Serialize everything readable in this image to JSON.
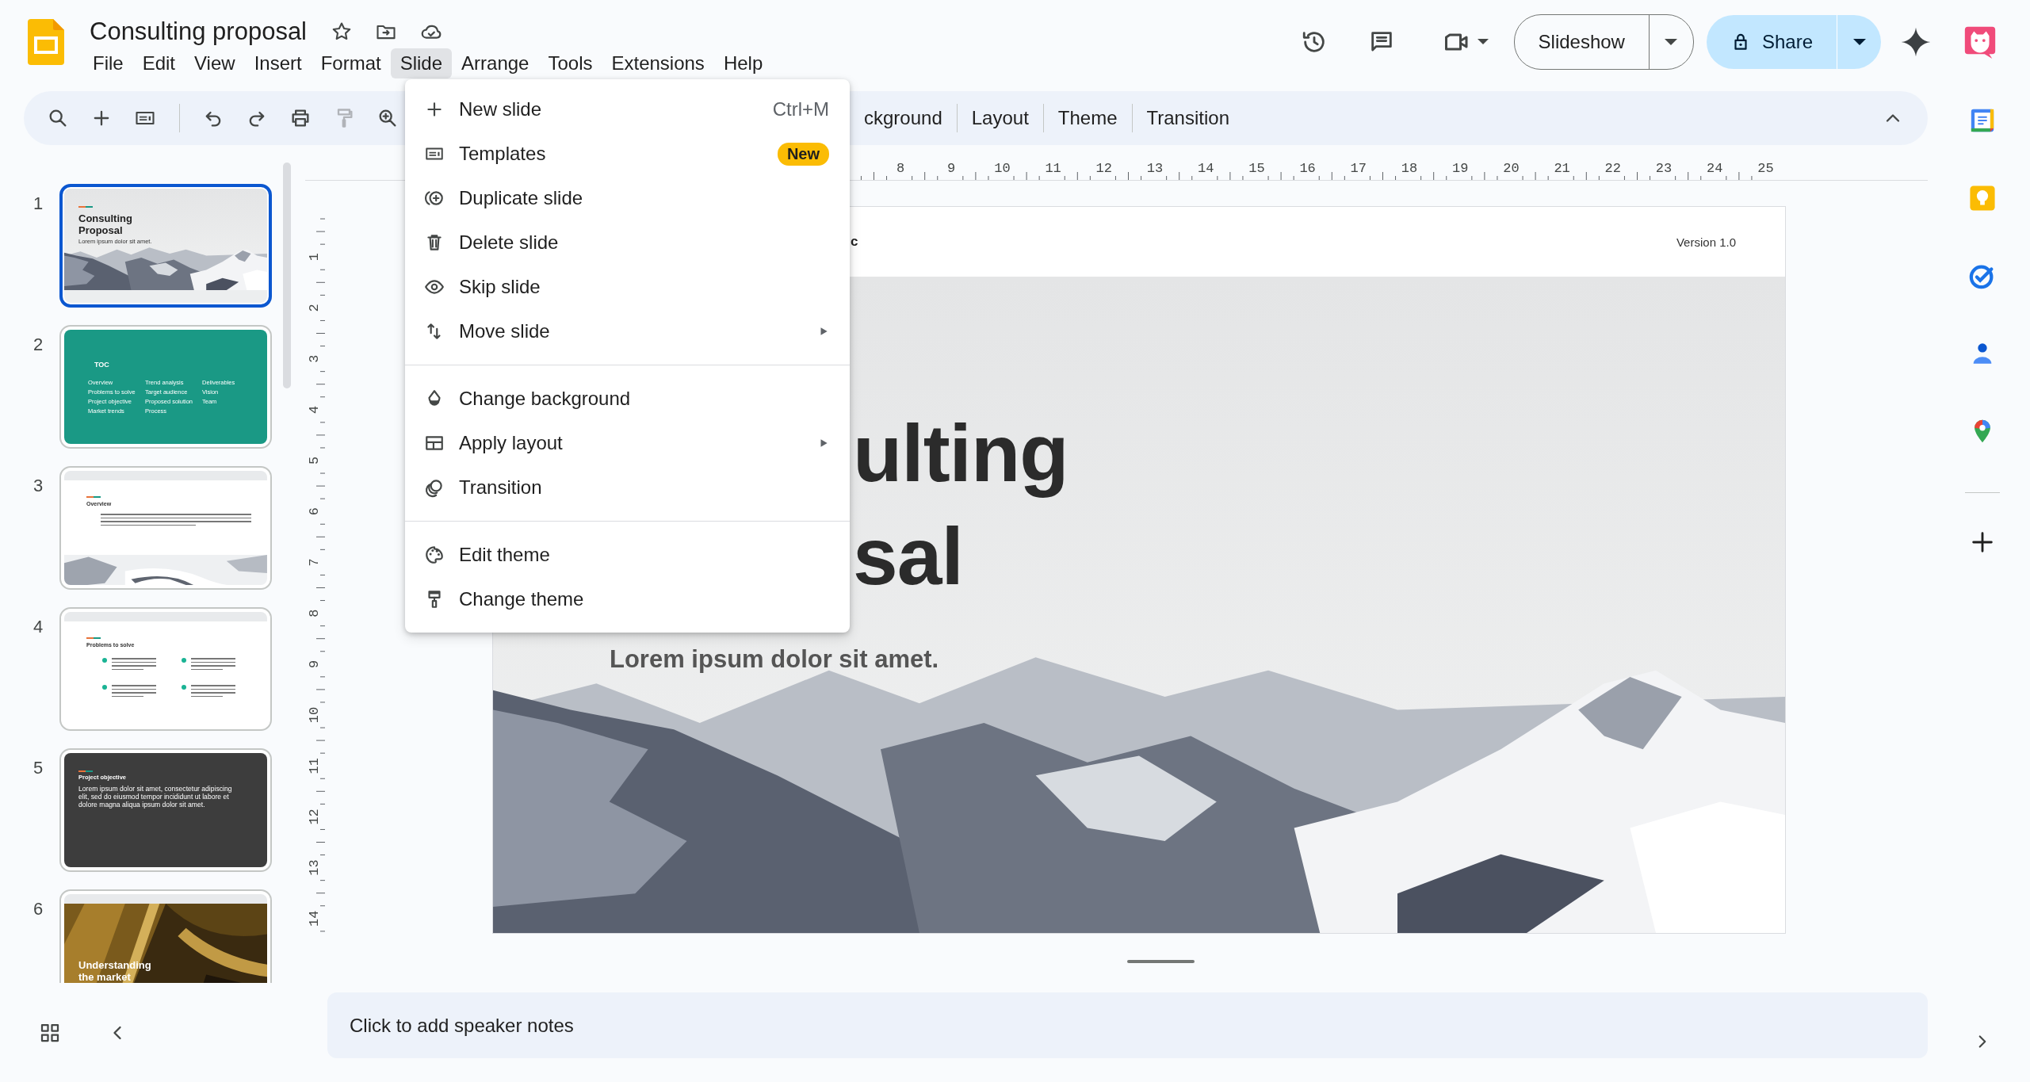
{
  "document": {
    "title": "Consulting proposal"
  },
  "menu_bar": [
    {
      "label": "File",
      "selected": false
    },
    {
      "label": "Edit",
      "selected": false
    },
    {
      "label": "View",
      "selected": false
    },
    {
      "label": "Insert",
      "selected": false
    },
    {
      "label": "Format",
      "selected": false
    },
    {
      "label": "Slide",
      "selected": true
    },
    {
      "label": "Arrange",
      "selected": false
    },
    {
      "label": "Tools",
      "selected": false
    },
    {
      "label": "Extensions",
      "selected": false
    },
    {
      "label": "Help",
      "selected": false
    }
  ],
  "header_actions": {
    "slideshow": "Slideshow",
    "share": "Share"
  },
  "toolbar": {
    "buttons": [
      "ckground",
      "Layout",
      "Theme",
      "Transition"
    ]
  },
  "slide_menu": {
    "groups": [
      [
        {
          "label": "New slide",
          "shortcut": "Ctrl+M",
          "submenu": false
        },
        {
          "label": "Templates",
          "badge": "New",
          "submenu": false
        },
        {
          "label": "Duplicate slide",
          "submenu": false
        },
        {
          "label": "Delete slide",
          "submenu": false
        },
        {
          "label": "Skip slide",
          "submenu": false
        },
        {
          "label": "Move slide",
          "submenu": true
        }
      ],
      [
        {
          "label": "Change background",
          "submenu": false
        },
        {
          "label": "Apply layout",
          "submenu": true
        },
        {
          "label": "Transition",
          "submenu": false
        }
      ],
      [
        {
          "label": "Edit theme",
          "submenu": false
        },
        {
          "label": "Change theme",
          "submenu": false
        }
      ]
    ]
  },
  "slides": [
    {
      "number": "1",
      "selected": true,
      "kind": "title",
      "title_lines": [
        "Consulting",
        "Proposal"
      ],
      "subtitle": "Lorem ipsum dolor sit amet."
    },
    {
      "number": "2",
      "selected": false,
      "kind": "toc",
      "title": "TOC",
      "columns": [
        [
          "Overview",
          "Problems to solve",
          "Project objective",
          "Market trends"
        ],
        [
          "Trend analysis",
          "Target audience",
          "Proposed solution",
          "Process"
        ],
        [
          "Deliverables",
          "Vision",
          "Team"
        ]
      ]
    },
    {
      "number": "3",
      "selected": false,
      "kind": "overview",
      "title": "Overview"
    },
    {
      "number": "4",
      "selected": false,
      "kind": "bullets",
      "title": "Problems to solve"
    },
    {
      "number": "5",
      "selected": false,
      "kind": "statement",
      "label": "Project objective",
      "text": "Lorem ipsum dolor sit amet, consectetur adipiscing elit, sed do eiusmod tempor incididunt ut labore et dolore magna aliqua ipsum dolor sit amet."
    },
    {
      "number": "6",
      "selected": false,
      "kind": "image_title",
      "title_lines": [
        "Understanding",
        "the market"
      ]
    }
  ],
  "horizontal_ruler": [
    "8",
    "9",
    "10",
    "11",
    "12",
    "13",
    "14",
    "15",
    "16",
    "17",
    "18",
    "19",
    "20",
    "21",
    "22",
    "23",
    "24",
    "25"
  ],
  "vertical_ruler": [
    "1",
    "2",
    "3",
    "4",
    "5",
    "6",
    "7",
    "8",
    "9",
    "10",
    "11",
    "12",
    "13",
    "14"
  ],
  "canvas": {
    "header_left": "c",
    "header_right": "Version 1.0",
    "title_lines": [
      "ulting",
      "sal"
    ],
    "subtitle": "Lorem ipsum dolor sit amet."
  },
  "speaker_notes": {
    "placeholder": "Click to add speaker notes"
  }
}
